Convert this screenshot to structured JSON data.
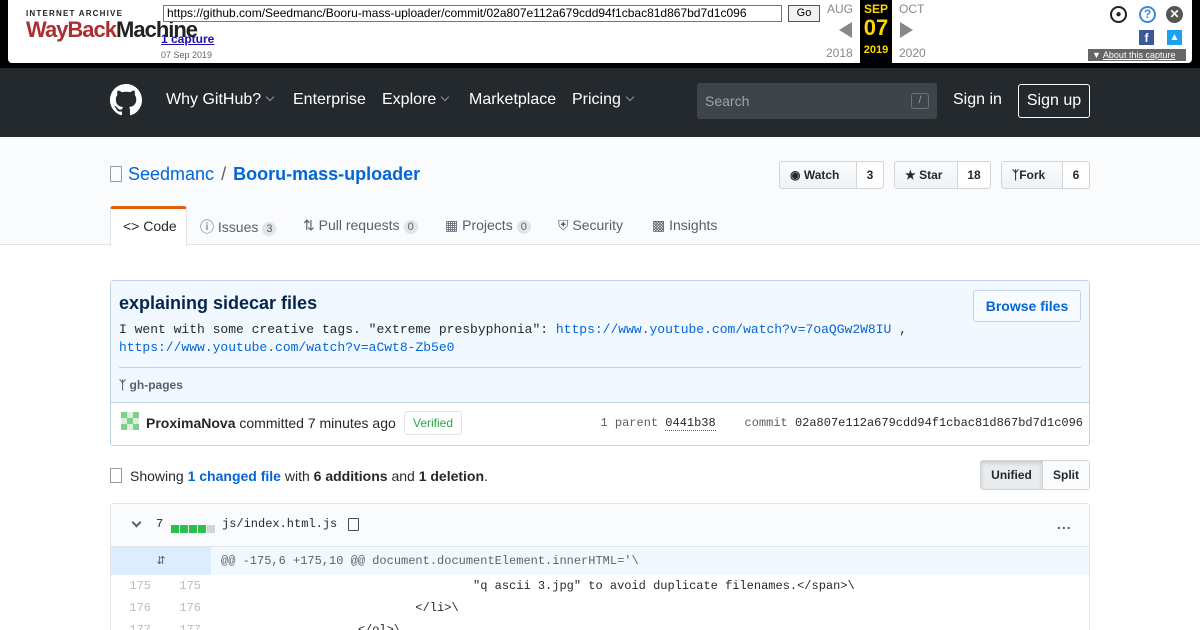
{
  "wayback": {
    "logo_top": "INTERNET ARCHIVE",
    "logo_way": "WayBack",
    "logo_machine": "Machine",
    "url": "https://github.com/Seedmanc/Booru-mass-uploader/commit/02a807e112a679cdd94f1cbac81d867bd7d1c096",
    "go_label": "Go",
    "captures": "1 capture",
    "capture_date": "07 Sep 2019",
    "prev_month": "AUG",
    "cur_month": "SEP",
    "next_month": "OCT",
    "cur_day": "07",
    "prev_year": "2018",
    "cur_year": "2019",
    "next_year": "2020",
    "about": "About this capture"
  },
  "header": {
    "nav": [
      "Why GitHub?",
      "Enterprise",
      "Explore",
      "Marketplace",
      "Pricing"
    ],
    "search_placeholder": "Search",
    "search_key": "/",
    "sign_in": "Sign in",
    "sign_up": "Sign up"
  },
  "repo": {
    "owner": "Seedmanc",
    "sep": "/",
    "name": "Booru-mass-uploader",
    "watch_label": "Watch",
    "watch_count": "3",
    "star_label": "Star",
    "star_count": "18",
    "fork_label": "Fork",
    "fork_count": "6",
    "tabs": {
      "code": "Code",
      "issues": "Issues",
      "issues_count": "3",
      "pulls": "Pull requests",
      "pulls_count": "0",
      "projects": "Projects",
      "projects_count": "0",
      "security": "Security",
      "insights": "Insights"
    }
  },
  "commit": {
    "title": "explaining sidecar files",
    "desc_prefix": "I went with some creative tags. \"extreme presbyphonia\": ",
    "link1": "https://www.youtube.com/watch?v=7oaQGw2W8IU",
    "desc_mid": " ,",
    "link2": "https://www.youtube.com/watch?v=aCwt8-Zb5e0",
    "browse": "Browse files",
    "branch": "gh-pages",
    "author": "ProximaNova",
    "action": "committed 7 minutes ago",
    "verified": "Verified",
    "parent_label": "1 parent",
    "parent_sha": "0441b38",
    "commit_label": "commit",
    "commit_sha": "02a807e112a679cdd94f1cbac81d867bd7d1c096"
  },
  "toc": {
    "showing": "Showing",
    "changed": "1 changed file",
    "with": "with",
    "additions": "6 additions",
    "and": "and",
    "deletions": "1 deletion",
    "end": ".",
    "unified": "Unified",
    "split": "Split"
  },
  "file": {
    "count": "7",
    "name": "js/index.html.js",
    "more": "...",
    "hunk": "@@ -175,6 +175,10 @@ document.documentElement.innerHTML='\\",
    "rows": [
      {
        "old": "175",
        "new": "175",
        "code": "                                   \"q ascii 3.jpg\" to avoid duplicate filenames.</span>\\"
      },
      {
        "old": "176",
        "new": "176",
        "code": "                           </li>\\"
      },
      {
        "old": "177",
        "new": "177",
        "code": "                   </ol>\\"
      }
    ]
  },
  "colors": {
    "header_bg": "#24292e",
    "link": "#0366d6",
    "accent_tab": "#e36209",
    "added": "#2cbe4e",
    "commit_bg": "#f1f8ff",
    "verified": "#28a745"
  }
}
